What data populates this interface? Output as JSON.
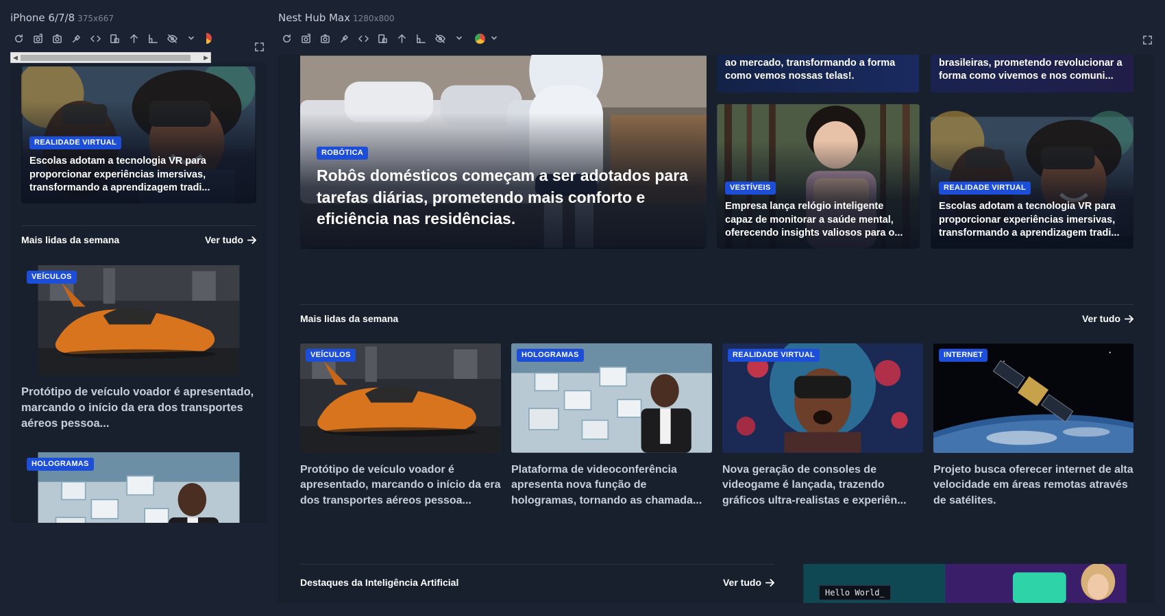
{
  "devices": {
    "phone": {
      "name": "iPhone 6/7/8",
      "size": "375x667"
    },
    "nest": {
      "name": "Nest Hub Max",
      "size": "1280x800"
    }
  },
  "toolbar_icons": [
    "refresh-icon",
    "screenshot-viewport-icon",
    "camera-icon",
    "color-picker-icon",
    "code-icon",
    "rotate-icon",
    "scroll-top-icon",
    "ruler-icon",
    "visibility-icon",
    "chrome-icon"
  ],
  "colors": {
    "page_bg": "#1b2333",
    "accent": "#1d4ed8",
    "card_title": "#ffffff",
    "tile_title": "#c8cfdb"
  },
  "phone": {
    "hero": {
      "badge": "REALIDADE VIRTUAL",
      "title": "Escolas adotam a tecnologia VR para proporcionar experiências imersivas, transformando a aprendizagem tradi..."
    },
    "section": {
      "title": "Mais lidas da semana",
      "see_all": "Ver tudo"
    },
    "items": [
      {
        "badge": "VEÍCULOS",
        "title": "Protótipo de veículo voador é apresentado, marcando o início da era dos transportes aéreos pessoa..."
      },
      {
        "badge": "HOLOGRAMAS",
        "title": ""
      }
    ]
  },
  "nest": {
    "top_partial": [
      {
        "title": "ao mercado, transformando a forma como vemos nossas telas!."
      },
      {
        "title": "brasileiras, prometendo revolucionar a forma como vivemos e nos comuni..."
      }
    ],
    "main_card": {
      "badge": "ROBÓTICA",
      "title": "Robôs domésticos começam a ser adotados para tarefas diárias, prometendo mais conforto e eficiência nas residências."
    },
    "side_cards": [
      {
        "badge": "VESTÍVEIS",
        "title": "Empresa lança relógio inteligente capaz de monitorar a saúde mental, oferecendo insights valiosos para o..."
      },
      {
        "badge": "REALIDADE VIRTUAL",
        "title": "Escolas adotam a tecnologia VR para proporcionar experiências imersivas, transformando a aprendizagem tradi..."
      }
    ],
    "most_read": {
      "title": "Mais lidas da semana",
      "see_all": "Ver tudo",
      "items": [
        {
          "badge": "VEÍCULOS",
          "title": "Protótipo de veículo voador é apresentado, marcando o início da era dos transportes aéreos pessoa..."
        },
        {
          "badge": "HOLOGRAMAS",
          "title": "Plataforma de videoconferência apresenta nova função de hologramas, tornando as chamada..."
        },
        {
          "badge": "REALIDADE VIRTUAL",
          "title": "Nova geração de consoles de videogame é lançada, trazendo gráficos ultra-realistas e experiên..."
        },
        {
          "badge": "INTERNET",
          "title": "Projeto busca oferecer internet de alta velocidade em áreas remotas através de satélites."
        }
      ]
    },
    "ai_section": {
      "title": "Destaques da Inteligência Artificial",
      "see_all": "Ver tudo"
    },
    "promo": {
      "code": "Hello World_"
    }
  }
}
